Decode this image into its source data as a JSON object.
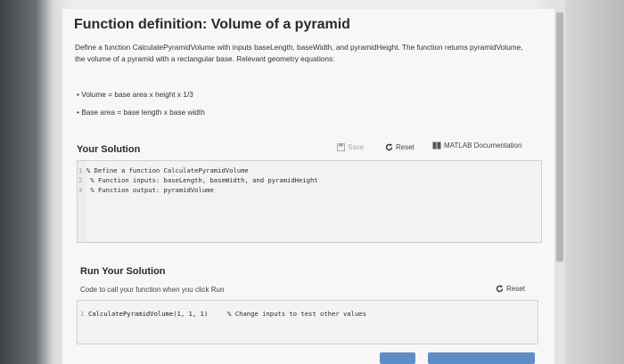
{
  "title": "Function definition: Volume of a pyramid",
  "description": "Define a function CalculatePyramidVolume with inputs baseLength, baseWidth, and pyramidHeight. The function returns pyramidVolume, the volume of a pyramid with a rectangular base. Relevant geometry equations:",
  "equations": [
    "Volume = base area x height x 1/3",
    "Base area = base length x base width"
  ],
  "solution": {
    "heading": "Your Solution",
    "save_label": "Save",
    "reset_label": "Reset",
    "docs_label": "MATLAB Documentation",
    "code_lines": [
      {
        "num": "1",
        "code": "% Define a function CalculatePyramidVolume"
      },
      {
        "num": "2",
        "code": "   % Function inputs: baseLength, baseWidth, and pyramidHeight"
      },
      {
        "num": "3",
        "code": "   % Function output: pyramidVolume"
      }
    ]
  },
  "run": {
    "heading": "Run Your Solution",
    "subtitle": "Code to call your function when you click Run",
    "reset_label": "Reset",
    "line_num": "1",
    "code": "CalculatePyramidVolume(1, 1, 1)",
    "comment": "% Change inputs to test other values"
  }
}
